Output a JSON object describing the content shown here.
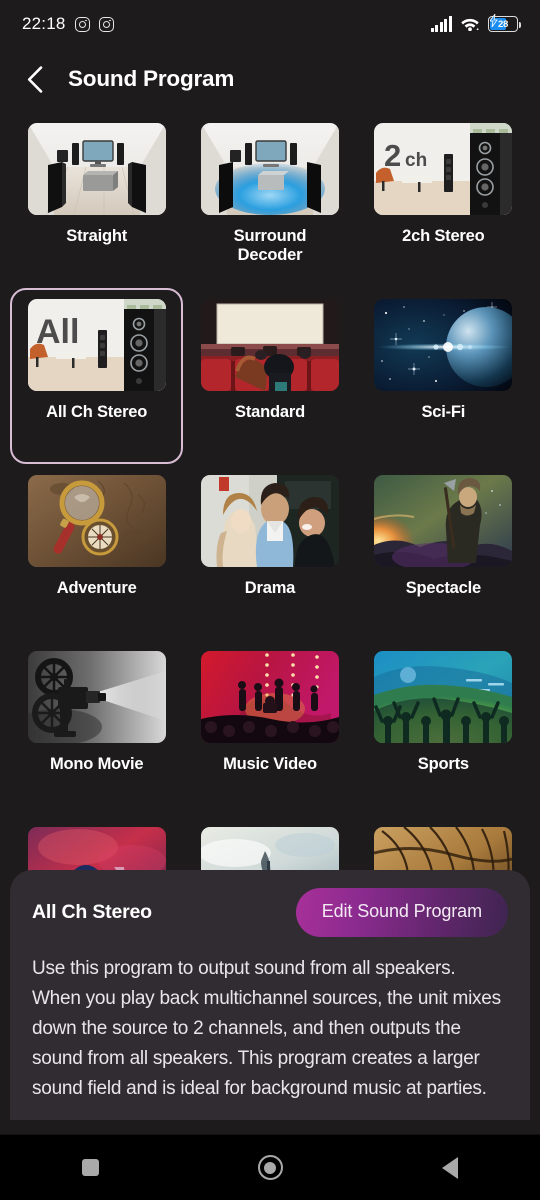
{
  "status_bar": {
    "time": "22:18",
    "notification_icons": [
      "instagram-icon",
      "instagram-icon"
    ],
    "signal_icon": "cellular-signal-icon",
    "wifi_icon": "wifi-icon",
    "battery_level": "28",
    "battery_charging": true
  },
  "app_bar": {
    "back_icon": "chevron-left-icon",
    "title": "Sound Program"
  },
  "grid": {
    "selected_program": "All Ch Stereo",
    "programs": [
      {
        "label": "Straight",
        "art": "straight"
      },
      {
        "label": "Surround\nDecoder",
        "art": "surround-decoder"
      },
      {
        "label": "2ch Stereo",
        "art": "2ch-stereo"
      },
      {
        "label": "All Ch Stereo",
        "art": "all-ch-stereo"
      },
      {
        "label": "Standard",
        "art": "standard"
      },
      {
        "label": "Sci-Fi",
        "art": "sci-fi"
      },
      {
        "label": "Adventure",
        "art": "adventure"
      },
      {
        "label": "Drama",
        "art": "drama"
      },
      {
        "label": "Spectacle",
        "art": "spectacle"
      },
      {
        "label": "Mono Movie",
        "art": "mono-movie"
      },
      {
        "label": "Music Video",
        "art": "music-video"
      },
      {
        "label": "Sports",
        "art": "sports"
      },
      {
        "label": "",
        "art": "concert-hall"
      },
      {
        "label": "",
        "art": "sky"
      },
      {
        "label": "",
        "art": "roof"
      }
    ]
  },
  "detail_sheet": {
    "title": "All Ch Stereo",
    "edit_button_label": "Edit Sound Program",
    "description": "Use this program to output sound from all speakers. When you play back multichannel sources, the unit mixes down the source to 2 channels, and then outputs the sound from all speakers. This program creates a larger sound field and is ideal for background music at parties."
  },
  "nav_bar": {
    "recents_label": "recents-icon",
    "home_label": "home-icon",
    "back_label": "back-icon"
  },
  "colors": {
    "background": "#1d1b1c",
    "sheet": "#312c32",
    "selection_border": "#d7bcd4",
    "accent_magenta": "#a8309a",
    "accent_purple": "#3e2550",
    "battery_blue": "#1b8cf0"
  }
}
